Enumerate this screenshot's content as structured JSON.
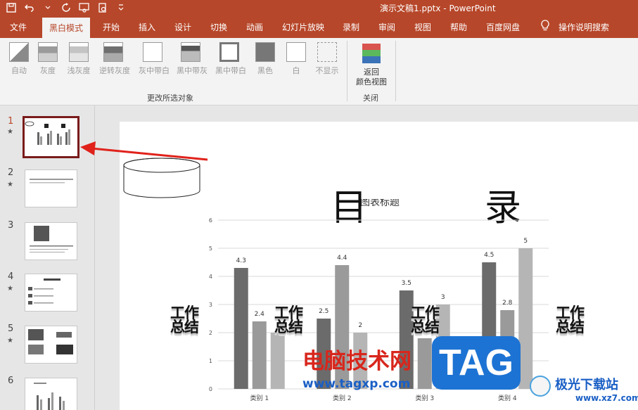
{
  "window": {
    "title": "演示文稿1.pptx  -  PowerPoint"
  },
  "tabs": [
    {
      "label": "文件"
    },
    {
      "label": "黑白模式"
    },
    {
      "label": "开始"
    },
    {
      "label": "插入"
    },
    {
      "label": "设计"
    },
    {
      "label": "切换"
    },
    {
      "label": "动画"
    },
    {
      "label": "幻灯片放映"
    },
    {
      "label": "录制"
    },
    {
      "label": "审阅"
    },
    {
      "label": "视图"
    },
    {
      "label": "帮助"
    },
    {
      "label": "百度网盘"
    },
    {
      "label": "操作说明搜索"
    }
  ],
  "ribbon": {
    "buttons": [
      {
        "label": "自动"
      },
      {
        "label": "灰度"
      },
      {
        "label": "浅灰度"
      },
      {
        "label": "逆转灰度"
      },
      {
        "label": "灰中带白"
      },
      {
        "label": "黑中带灰"
      },
      {
        "label": "黑中带白"
      },
      {
        "label": "黑色"
      },
      {
        "label": "白"
      },
      {
        "label": "不显示"
      }
    ],
    "group_change": "更改所选对象",
    "return_line1": "返回",
    "return_line2": "颜色视图",
    "group_close": "关闭"
  },
  "thumbnails": [
    {
      "num": "1",
      "star": "★"
    },
    {
      "num": "2",
      "star": "★"
    },
    {
      "num": "3",
      "star": ""
    },
    {
      "num": "4",
      "star": "★"
    },
    {
      "num": "5",
      "star": "★"
    },
    {
      "num": "6",
      "star": ""
    }
  ],
  "slide": {
    "title_left": "目",
    "title_right": "录",
    "work_line1": "工作",
    "work_line2": "总结",
    "chart_data": {
      "type": "bar",
      "title": "图表标题",
      "categories": [
        "类别 1",
        "类别 2",
        "类别 3",
        "类别 4"
      ],
      "series": [
        {
          "values": [
            4.3,
            2.5,
            3.5,
            4.5
          ]
        },
        {
          "values": [
            2.4,
            4.4,
            1.8,
            2.8
          ]
        },
        {
          "values": [
            2,
            2,
            3,
            5
          ]
        }
      ],
      "data_labels": [
        [
          "4.3",
          "2.5",
          "3.5",
          "4.5"
        ],
        [
          "2.4",
          "4.4",
          "",
          "2.8"
        ],
        [
          "",
          "2",
          "3",
          "5"
        ]
      ],
      "ylim": [
        0,
        6
      ],
      "yticks": [
        "0",
        "1",
        "2",
        "3",
        "4",
        "5",
        "6"
      ],
      "grid": true,
      "legend": "bottom",
      "colors": [
        "#6b6b6b",
        "#9a9a9a",
        "#b5b5b5"
      ]
    }
  },
  "watermarks": {
    "cn": "电脑技术网",
    "url": "www.tagxp.com",
    "tag": "TAG",
    "jg": "极光下载站",
    "jg_url": "www.xz7.com"
  }
}
